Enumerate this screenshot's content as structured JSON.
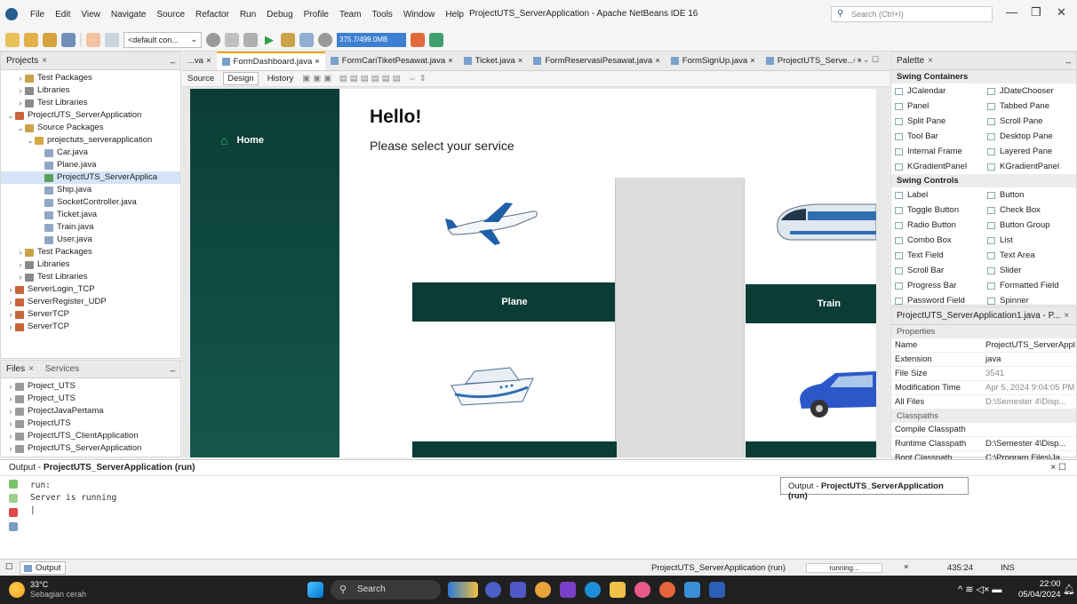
{
  "menu": {
    "items": [
      "File",
      "Edit",
      "View",
      "Navigate",
      "Source",
      "Refactor",
      "Run",
      "Debug",
      "Profile",
      "Team",
      "Tools",
      "Window",
      "Help"
    ],
    "window_title": "ProjectUTS_ServerApplication - Apache NetBeans IDE 16",
    "search_placeholder": "Search (Ctrl+I)"
  },
  "toolbar": {
    "config": "<default con...",
    "memory": "375.7/499.0MB"
  },
  "projects": {
    "title": "Projects",
    "items": [
      {
        "label": "Test Packages",
        "depth": 1,
        "arrow": "›",
        "icon": "package"
      },
      {
        "label": "Libraries",
        "depth": 1,
        "arrow": "›",
        "icon": "lib"
      },
      {
        "label": "Test Libraries",
        "depth": 1,
        "arrow": "›",
        "icon": "lib"
      },
      {
        "label": "ProjectUTS_ServerApplication",
        "depth": 0,
        "arrow": "⌄",
        "icon": "project"
      },
      {
        "label": "Source Packages",
        "depth": 1,
        "arrow": "⌄",
        "icon": "package"
      },
      {
        "label": "projectuts_serverapplication",
        "depth": 2,
        "arrow": "⌄",
        "icon": "pkg"
      },
      {
        "label": "Car.java",
        "depth": 3,
        "arrow": "",
        "icon": "java"
      },
      {
        "label": "Plane.java",
        "depth": 3,
        "arrow": "",
        "icon": "java"
      },
      {
        "label": "ProjectUTS_ServerApplica",
        "depth": 3,
        "arrow": "",
        "icon": "main",
        "selected": true
      },
      {
        "label": "Ship.java",
        "depth": 3,
        "arrow": "",
        "icon": "java"
      },
      {
        "label": "SocketController.java",
        "depth": 3,
        "arrow": "",
        "icon": "java"
      },
      {
        "label": "Ticket.java",
        "depth": 3,
        "arrow": "",
        "icon": "java"
      },
      {
        "label": "Train.java",
        "depth": 3,
        "arrow": "",
        "icon": "java"
      },
      {
        "label": "User.java",
        "depth": 3,
        "arrow": "",
        "icon": "java"
      },
      {
        "label": "Test Packages",
        "depth": 1,
        "arrow": "›",
        "icon": "package"
      },
      {
        "label": "Libraries",
        "depth": 1,
        "arrow": "›",
        "icon": "lib"
      },
      {
        "label": "Test Libraries",
        "depth": 1,
        "arrow": "›",
        "icon": "lib"
      },
      {
        "label": "ServerLogin_TCP",
        "depth": 0,
        "arrow": "›",
        "icon": "project"
      },
      {
        "label": "ServerRegister_UDP",
        "depth": 0,
        "arrow": "›",
        "icon": "project"
      },
      {
        "label": "ServerTCP",
        "depth": 0,
        "arrow": "›",
        "icon": "project"
      },
      {
        "label": "ServerTCP",
        "depth": 0,
        "arrow": "›",
        "icon": "project"
      }
    ]
  },
  "files": {
    "tab1": "Files",
    "tab2": "Services",
    "items": [
      "Project_UTS",
      "Project_UTS",
      "ProjectJavaPertama",
      "ProjectUTS",
      "ProjectUTS_ClientApplication",
      "ProjectUTS_ServerApplication"
    ]
  },
  "editor": {
    "tabs": [
      {
        "label": "...va",
        "active": false
      },
      {
        "label": "FormDashboard.java",
        "active": true
      },
      {
        "label": "FormCariTiketPesawat.java",
        "active": false
      },
      {
        "label": "Ticket.java",
        "active": false
      },
      {
        "label": "FormReservasiPesawat.java",
        "active": false
      },
      {
        "label": "FormSignUp.java",
        "active": false
      },
      {
        "label": "ProjectUTS_Serve...",
        "active": false
      }
    ],
    "modes": [
      "Source",
      "Design",
      "History"
    ],
    "active_mode": "Design"
  },
  "form": {
    "home": "Home",
    "hello": "Hello!",
    "subtitle": "Please select your service",
    "services": {
      "plane": "Plane",
      "train": "Train"
    }
  },
  "palette": {
    "title": "Palette",
    "containers_label": "Swing Containers",
    "containers": [
      "JCalendar",
      "JDateChooser",
      "Panel",
      "Tabbed Pane",
      "Split Pane",
      "Scroll Pane",
      "Tool Bar",
      "Desktop Pane",
      "Internal Frame",
      "Layered Pane",
      "KGradientPanel",
      "KGradientPanel"
    ],
    "controls_label": "Swing Controls",
    "controls": [
      "Label",
      "Button",
      "Toggle Button",
      "Check Box",
      "Radio Button",
      "Button Group",
      "Combo Box",
      "List",
      "Text Field",
      "Text Area",
      "Scroll Bar",
      "Slider",
      "Progress Bar",
      "Formatted Field",
      "Password Field",
      "Spinner"
    ]
  },
  "properties": {
    "title": "ProjectUTS_ServerApplication1.java - P...",
    "section": "Properties",
    "rows": [
      {
        "k": "Name",
        "v": "ProjectUTS_ServerAppl..."
      },
      {
        "k": "Extension",
        "v": "java"
      },
      {
        "k": "File Size",
        "v": "3541",
        "dim": true
      },
      {
        "k": "Modification Time",
        "v": "Apr 5, 2024 9:04:05 PM",
        "dim": true
      },
      {
        "k": "All Files",
        "v": "D:\\Semester 4\\Disp...",
        "dim": true
      }
    ],
    "section2": "Classpaths",
    "rows2": [
      {
        "k": "Compile Classpath",
        "v": ""
      },
      {
        "k": "Runtime Classpath",
        "v": "D:\\Semester 4\\Disp..."
      },
      {
        "k": "Boot Classpath",
        "v": "C:\\Program Files\\Ja..."
      }
    ]
  },
  "output": {
    "title_prefix": "Output - ",
    "title_bold": "ProjectUTS_ServerApplication (run)",
    "lines": "run:\nServer is running\n|",
    "tooltip_prefix": "Output - ",
    "tooltip_bold": "ProjectUTS_ServerApplication (run)"
  },
  "status": {
    "output_tab": "Output",
    "run_label": "ProjectUTS_ServerApplication (run)",
    "progress": "running...",
    "position": "435:24",
    "mode": "INS"
  },
  "taskbar": {
    "temp": "33°C",
    "weather": "Sebagian cerah",
    "search": "Search",
    "time": "22:00",
    "date": "05/04/2024"
  },
  "colors": {
    "sidebar": "#0b3d36",
    "accent": "#f0a30a",
    "selection": "#d5e3f7"
  }
}
